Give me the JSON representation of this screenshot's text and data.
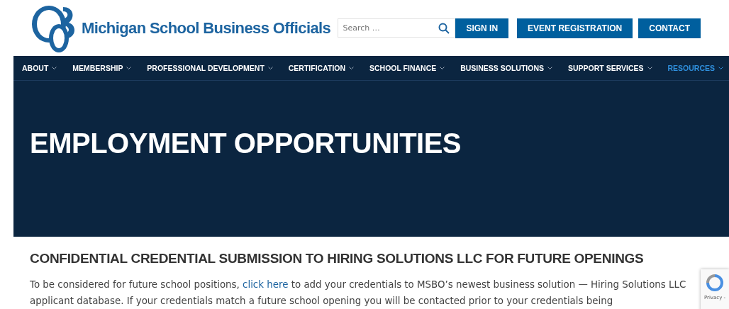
{
  "header": {
    "site_name": "Michigan School Business Officials",
    "search": {
      "placeholder": "Search …"
    },
    "buttons": [
      "SIGN IN",
      "EVENT REGISTRATION",
      "CONTACT"
    ]
  },
  "nav": [
    {
      "label": "ABOUT",
      "selected": false
    },
    {
      "label": "MEMBERSHIP",
      "selected": false
    },
    {
      "label": "PROFESSIONAL DEVELOPMENT",
      "selected": false
    },
    {
      "label": "CERTIFICATION",
      "selected": false
    },
    {
      "label": "SCHOOL FINANCE",
      "selected": false
    },
    {
      "label": "BUSINESS SOLUTIONS",
      "selected": false
    },
    {
      "label": "SUPPORT SERVICES",
      "selected": false
    },
    {
      "label": "RESOURCES",
      "selected": true
    }
  ],
  "hero": {
    "title": "EMPLOYMENT OPPORTUNITIES"
  },
  "content": {
    "heading": "CONFIDENTIAL CREDENTIAL SUBMISSION TO HIRING SOLUTIONS LLC FOR FUTURE OPENINGS",
    "text_before": "To be considered for future school positions,",
    "link": "click here",
    "text_after": "to add your credentials to MSBO’s newest business solution — Hiring Solutions LLC applicant database. If your credentials match a future school opening you will be contacted prior to your credentials being"
  },
  "recaptcha": {
    "label": "Privacy -"
  }
}
